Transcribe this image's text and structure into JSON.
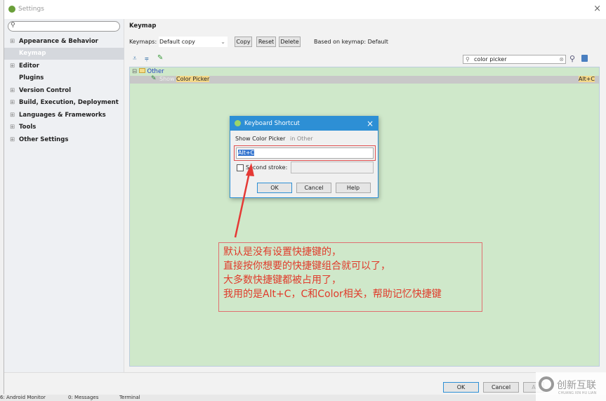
{
  "window": {
    "title": "Settings",
    "close": "×"
  },
  "sidebar": {
    "search_placeholder": "",
    "items": [
      {
        "label": "Appearance & Behavior",
        "expand": "⊞"
      },
      {
        "label": "Keymap",
        "expand": ""
      },
      {
        "label": "Editor",
        "expand": "⊞"
      },
      {
        "label": "Plugins",
        "expand": ""
      },
      {
        "label": "Version Control",
        "expand": "⊞"
      },
      {
        "label": "Build, Execution, Deployment",
        "expand": "⊞"
      },
      {
        "label": "Languages & Frameworks",
        "expand": "⊞"
      },
      {
        "label": "Tools",
        "expand": "⊞"
      },
      {
        "label": "Other Settings",
        "expand": "⊞"
      }
    ]
  },
  "main": {
    "title": "Keymap",
    "keymaps_label": "Keymaps:",
    "keymap_value": "Default copy",
    "copy": "Copy",
    "reset": "Reset",
    "delete": "Delete",
    "based_on": "Based on keymap: Default",
    "search_value": "color picker",
    "tree": {
      "group": "Other",
      "action_prefix": "Show ",
      "action_match": "Color Picker",
      "shortcut": "Alt+C"
    }
  },
  "dialog": {
    "title": "Keyboard Shortcut",
    "action": "Show Color Picker",
    "in_label": "in Other",
    "first_stroke": "Alt+C",
    "second_stroke_label": "Second stroke:",
    "second_stroke_checked": false,
    "ok": "OK",
    "cancel": "Cancel",
    "help": "Help"
  },
  "annotation": {
    "lines": [
      "默认是没有设置快捷键的，",
      "直接按你想要的快捷键组合就可以了，",
      "大多数快捷键都被占用了，",
      "我用的是Alt+C，C和Color相关，帮助记忆快捷键"
    ],
    "color": "#e03a2a"
  },
  "footer": {
    "ok": "OK",
    "cancel": "Cancel",
    "apply": "A"
  },
  "statusbar": {
    "items": [
      "6: Android Monitor",
      "0: Messages",
      "Terminal"
    ]
  },
  "watermark": {
    "text": "创新互联",
    "sub": "CHUANG XIN HU LIAN"
  }
}
